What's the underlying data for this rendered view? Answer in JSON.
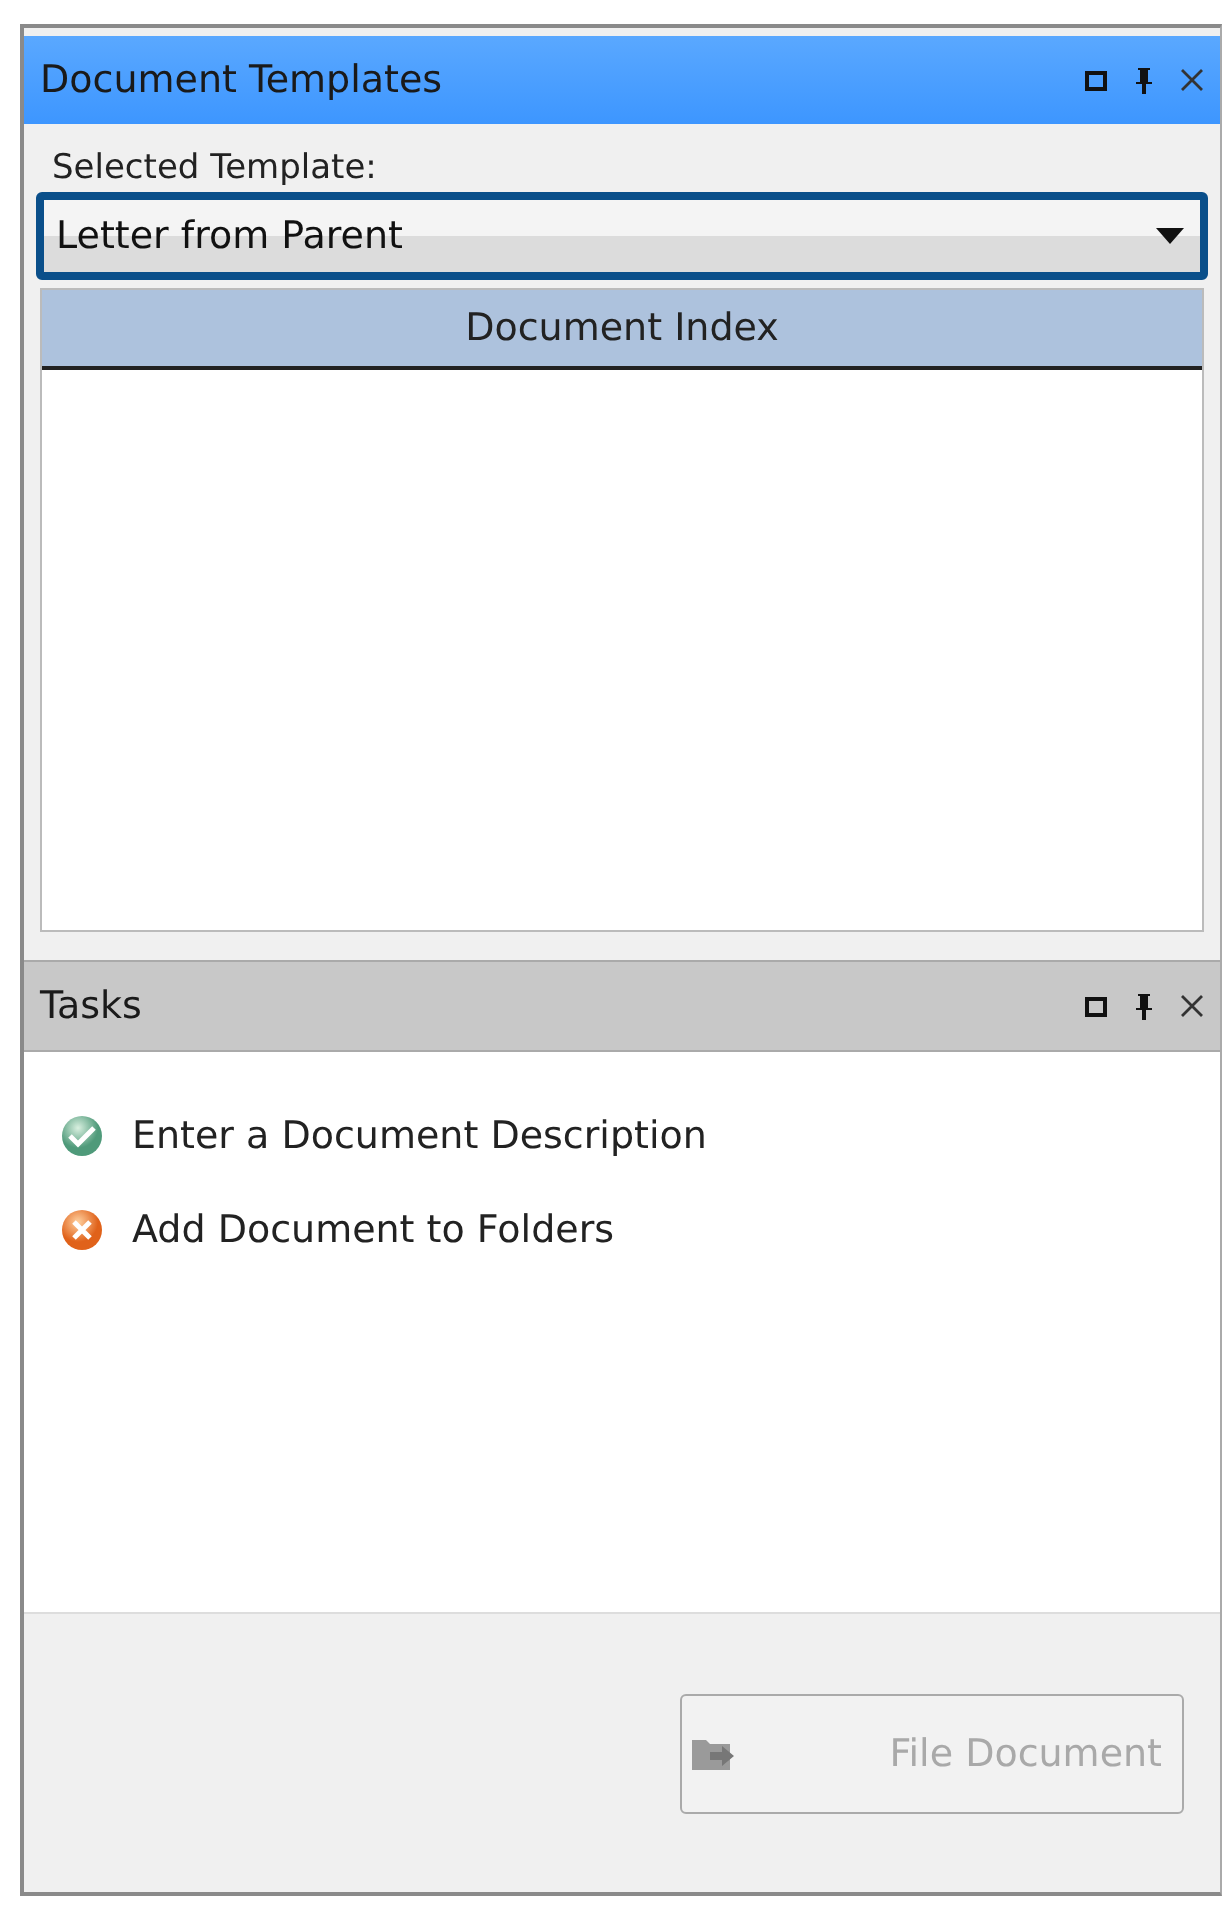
{
  "panels": [
    {
      "title": "Document Templates",
      "active": true
    },
    {
      "title": "Tasks",
      "active": false
    }
  ],
  "template": {
    "label": "Selected Template:",
    "value": "Letter from Parent",
    "focused": true
  },
  "index_grid": {
    "header": "Document Index"
  },
  "tasks": [
    {
      "label": "Enter a Document Description",
      "kind": "done"
    },
    {
      "label": "Add Document to Folders",
      "kind": "error"
    }
  ],
  "file_button": {
    "label": "File Document",
    "disabled": true
  }
}
